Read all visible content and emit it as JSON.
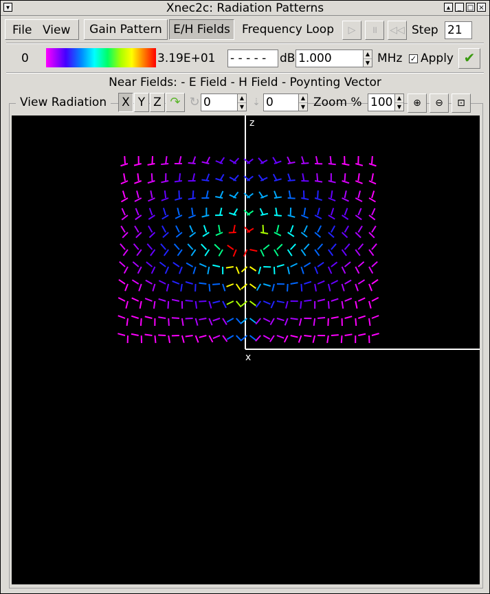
{
  "window": {
    "title": "Xnec2c: Radiation Patterns"
  },
  "menu": {
    "file": "File",
    "view": "View"
  },
  "toolbar": {
    "gain_pattern": "Gain Pattern",
    "eh_fields": "E/H Fields",
    "frequency_loop": "Frequency Loop",
    "play_icon": "play-icon",
    "pause_icon": "pause-icon",
    "rewind_icon": "rewind-icon",
    "step_label": "Step",
    "step_value": "21"
  },
  "scale": {
    "min_label": "0",
    "max_label": "3.19E+01",
    "db_value": "- - - - -",
    "db_label": "dB",
    "freq_value": "1.000",
    "freq_unit": "MHz",
    "apply_label": "Apply",
    "apply_checked": true
  },
  "near_fields_label": "Near Fields: - E Field - H Field - Poynting Vector",
  "view": {
    "label": "View Radiation",
    "x_btn": "X",
    "y_btn": "Y",
    "z_btn": "Z",
    "rot_value": "0",
    "incl_value": "0",
    "zoom_label": "Zoom %",
    "zoom_value": "100"
  },
  "plot": {
    "axis_z": "z",
    "axis_x": "x",
    "grid_cols": 19,
    "grid_rows": 11
  },
  "colors": {
    "background": "#dcdad5",
    "canvas": "#000000",
    "axes": "#ffffff"
  }
}
